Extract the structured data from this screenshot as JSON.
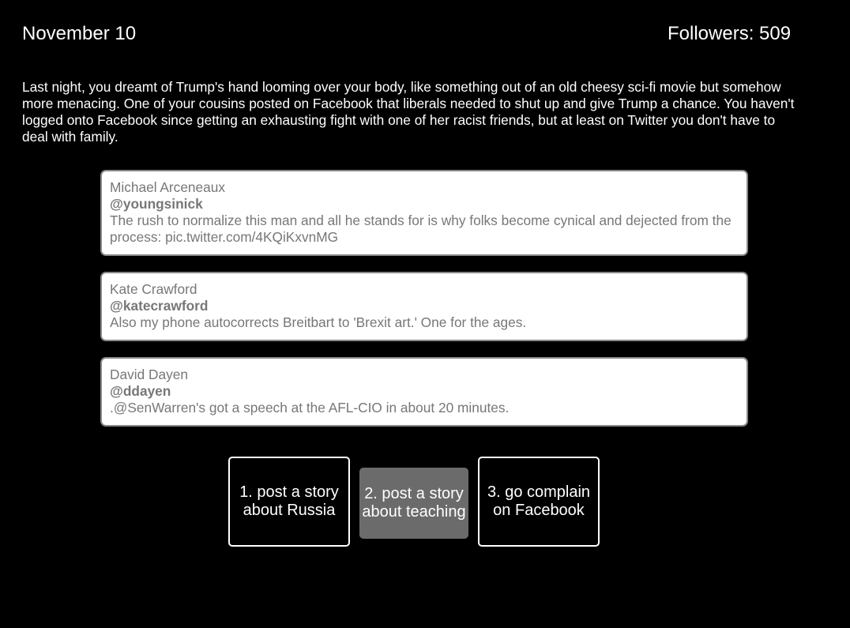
{
  "header": {
    "date": "November 10",
    "followers": "Followers: 509"
  },
  "narrative": "Last night, you dreamt of Trump's hand looming over your body, like something out of an old cheesy sci-fi movie but somehow more menacing. One of your cousins posted on Facebook that liberals needed to shut up and give Trump a chance. You haven't logged onto Facebook since getting an exhausting fight with one of her racist friends, but at least on Twitter you don't have to deal with family.",
  "tweets": [
    {
      "author": "Michael Arceneaux",
      "handle": "@youngsinick",
      "text": "The rush to normalize this man and all he stands for is why folks become cynical and dejected from the process: pic.twitter.com/4KQiKxvnMG"
    },
    {
      "author": "Kate Crawford",
      "handle": "@katecrawford",
      "text": "Also my phone autocorrects Breitbart to 'Brexit art.' One for the ages."
    },
    {
      "author": "David Dayen",
      "handle": "@ddayen",
      "text": ".@SenWarren's got a speech at the AFL-CIO in about 20 minutes."
    }
  ],
  "choices": [
    {
      "label": "1. post a story about Russia"
    },
    {
      "label": "2. post a story about teaching"
    },
    {
      "label": "3. go complain on Facebook"
    }
  ],
  "colors": {
    "background": "#000000",
    "text": "#ffffff",
    "tweet_text": "#777777",
    "highlighted_choice": "#6b6b6b"
  }
}
